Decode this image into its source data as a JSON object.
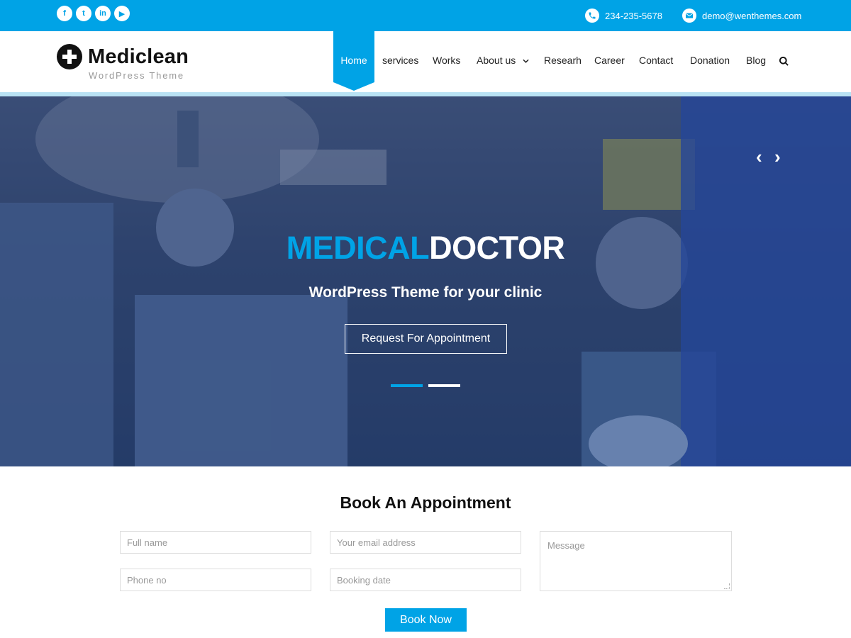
{
  "topbar": {
    "social": [
      {
        "icon": "facebook-icon",
        "glyph": "f"
      },
      {
        "icon": "twitter-icon",
        "glyph": "t"
      },
      {
        "icon": "linkedin-icon",
        "glyph": "in"
      },
      {
        "icon": "youtube-icon",
        "glyph": "▶"
      }
    ],
    "phone": "234-235-5678",
    "email": "demo@wenthemes.com"
  },
  "brand": {
    "title": "Mediclean",
    "tagline": "WordPress Theme"
  },
  "nav": {
    "items": [
      "Home",
      "services",
      "Works",
      "About us",
      "Researh",
      "Career",
      "Contact",
      "Donation",
      "Blog"
    ],
    "active": "Home"
  },
  "hero": {
    "title_blue": "MEDICAL",
    "title_white": "DOCTOR",
    "subtitle": "WordPress Theme for your clinic",
    "button": "Request For Appointment",
    "prev": "‹",
    "next": "›"
  },
  "appointment": {
    "title": "Book An Appointment",
    "placeholders": {
      "full_name": "Full name",
      "email": "Your email address",
      "phone": "Phone no",
      "date": "Booking date",
      "message": "Message"
    },
    "button": "Book Now"
  },
  "colors": {
    "accent": "#00a3e6",
    "dark": "#111111"
  }
}
